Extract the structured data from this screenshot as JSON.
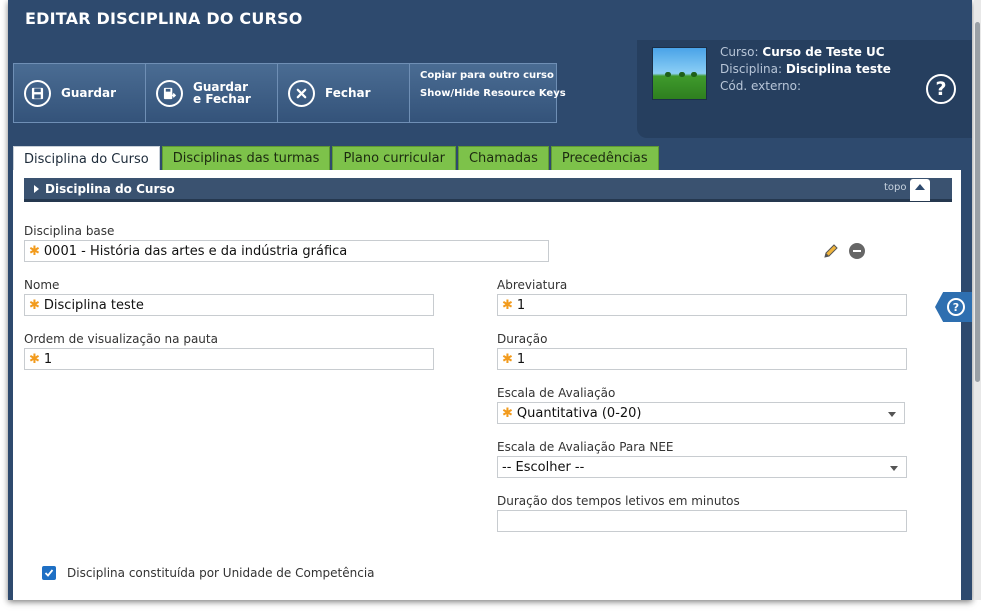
{
  "page": {
    "title": "EDITAR DISCIPLINA DO CURSO"
  },
  "toolbar": {
    "save_label": "Guardar",
    "save_close_label": "Guardar e Fechar",
    "close_label": "Fechar",
    "links": [
      "Copiar para outro curso",
      "Show/Hide Resource Keys"
    ]
  },
  "info": {
    "course_key": "Curso:",
    "course_value": "Curso de Teste UC",
    "discipline_key": "Disciplina:",
    "discipline_value": "Disciplina teste",
    "external_key": "Cód. externo:",
    "external_value": "",
    "help_glyph": "?"
  },
  "tabs": [
    {
      "label": "Disciplina do Curso",
      "active": true
    },
    {
      "label": "Disciplinas das turmas",
      "active": false
    },
    {
      "label": "Plano curricular",
      "active": false
    },
    {
      "label": "Chamadas",
      "active": false
    },
    {
      "label": "Precedências",
      "active": false
    }
  ],
  "section": {
    "title": "Disciplina do Curso",
    "top_link": "topo"
  },
  "form": {
    "required_mark": "✱",
    "disciplina_base": {
      "label": "Disciplina base",
      "value": "0001 - História das artes e da indústria gráfica"
    },
    "nome": {
      "label": "Nome",
      "value": "Disciplina teste"
    },
    "abreviatura": {
      "label": "Abreviatura",
      "value": "1"
    },
    "ordem": {
      "label": "Ordem de visualização na pauta",
      "value": "1"
    },
    "duracao": {
      "label": "Duração",
      "value": "1"
    },
    "escala": {
      "label": "Escala de Avaliação",
      "value": "Quantitativa (0-20)"
    },
    "escala_nee": {
      "label": "Escala de Avaliação Para NEE",
      "value": "-- Escolher --"
    },
    "duracao_tempos": {
      "label": "Duração dos tempos letivos em minutos",
      "value": ""
    },
    "unidade_competencia": {
      "label": "Disciplina constituída por Unidade de Competência",
      "checked": true
    }
  },
  "side_help": {
    "glyph": "?"
  },
  "colors": {
    "header_bg": "#2e4a6e",
    "tab_green": "#7dc24a",
    "required": "#f29b1d",
    "checkbox": "#1e6fc4"
  }
}
